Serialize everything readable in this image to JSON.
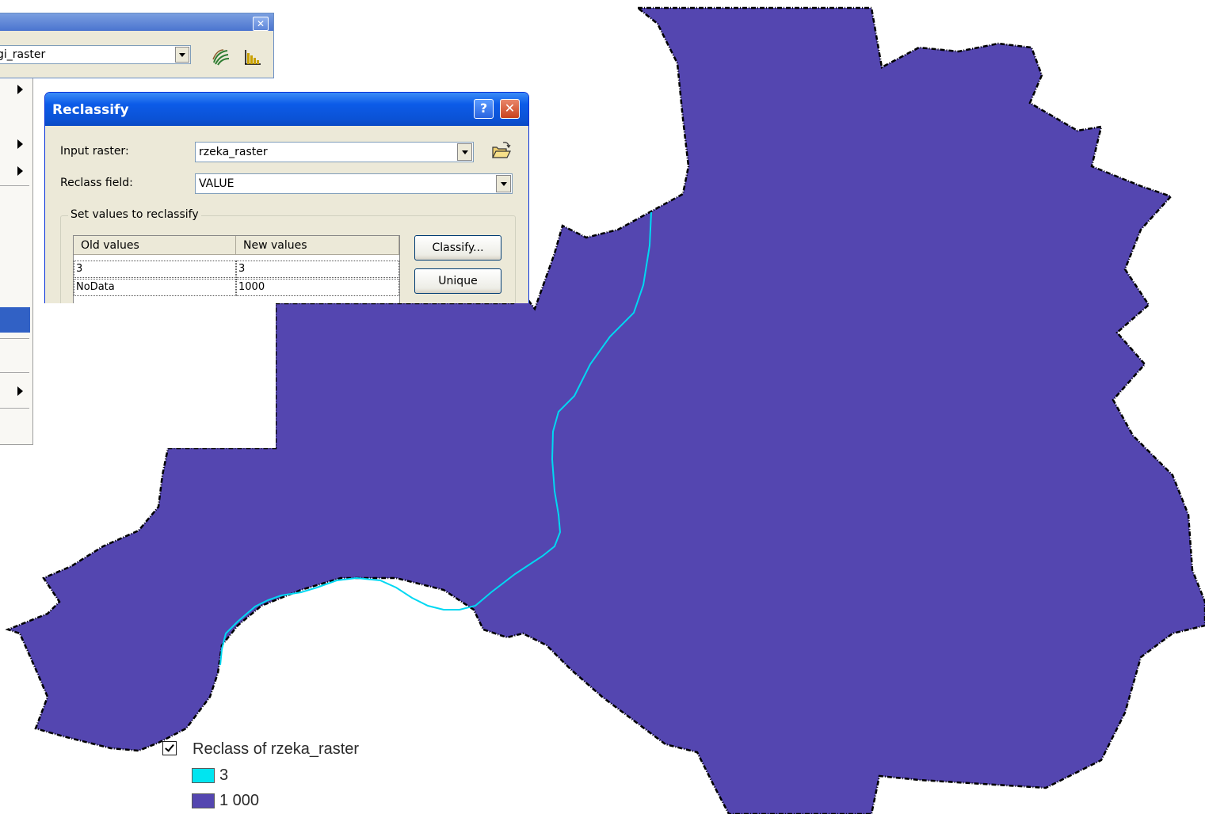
{
  "toolbar": {
    "layer_value": "gi_raster",
    "close_label": "✕"
  },
  "dialog": {
    "title": "Reclassify",
    "help_label": "?",
    "close_label": "✕",
    "input_raster_label": "Input raster:",
    "input_raster_value": "rzeka_raster",
    "reclass_field_label": "Reclass field:",
    "reclass_field_value": "VALUE",
    "group_label": "Set values to reclassify",
    "table": {
      "columns": [
        "Old values",
        "New values"
      ],
      "rows": [
        {
          "old": "3",
          "new": "3"
        },
        {
          "old": "NoData",
          "new": "1000"
        }
      ]
    },
    "classify_button": "Classify...",
    "unique_button": "Unique"
  },
  "legend": {
    "layer_name": "Reclass of rzeka_raster",
    "visible": true,
    "classes": [
      {
        "label": "3",
        "color": "#00E5F0"
      },
      {
        "label": "1 000",
        "color": "#5446B0"
      }
    ]
  },
  "map": {
    "fill_color": "#5446B0",
    "river_color": "#00D8F2",
    "boundary_color": "#000000"
  }
}
